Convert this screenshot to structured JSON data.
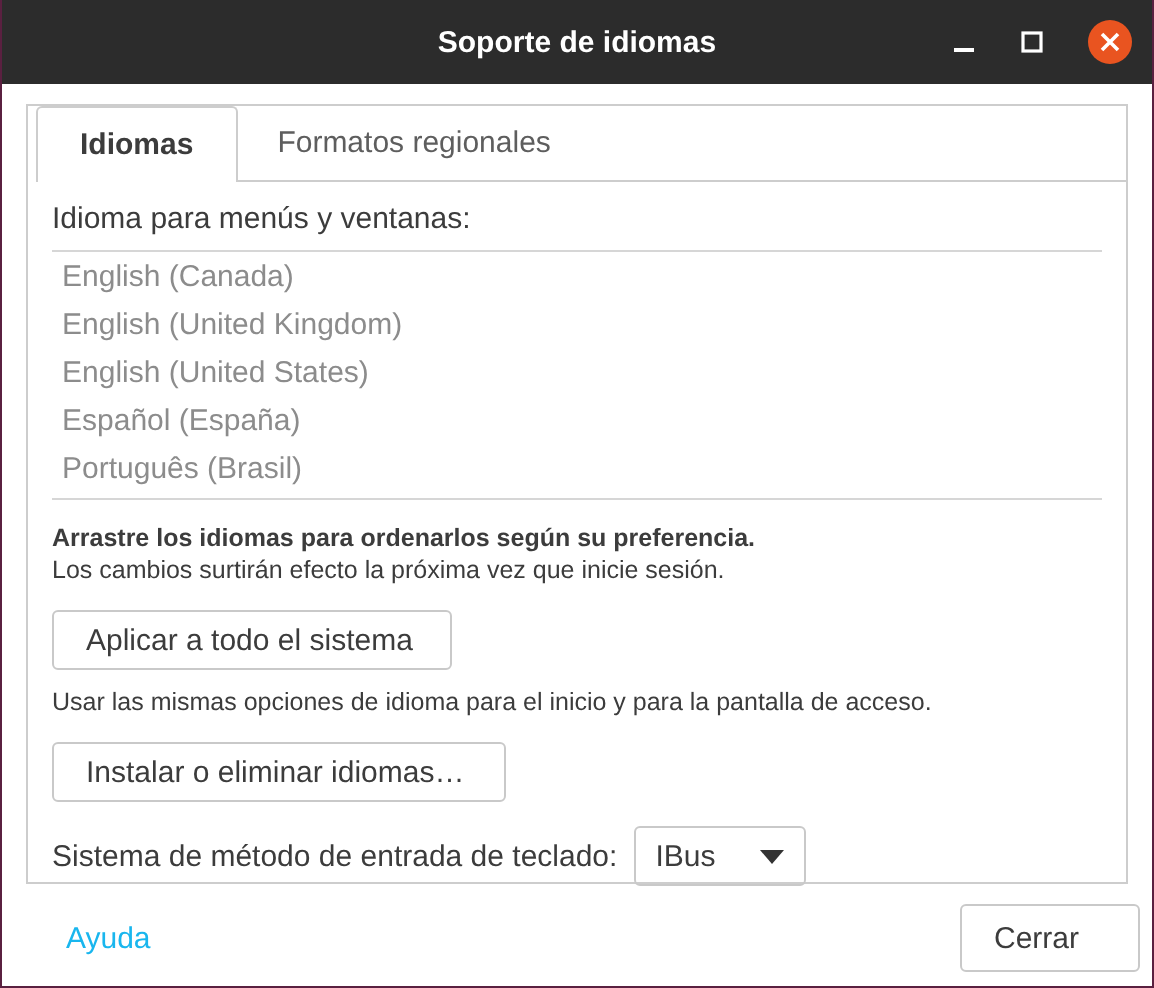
{
  "window": {
    "title": "Soporte de idiomas"
  },
  "tabs": [
    {
      "label": "Idiomas",
      "selected": true
    },
    {
      "label": "Formatos regionales",
      "selected": false
    }
  ],
  "languages": {
    "heading": "Idioma para menús y ventanas:",
    "items": [
      "English (Canada)",
      "English (United Kingdom)",
      "English (United States)",
      "Español (España)",
      "Português (Brasil)"
    ]
  },
  "hint": {
    "bold": "Arrastre los idiomas para ordenarlos según su preferencia.",
    "note": "Los cambios surtirán efecto la próxima vez que inicie sesión."
  },
  "apply_button": "Aplicar a todo el sistema",
  "apply_note": "Usar las mismas opciones de idioma para el inicio y para la pantalla de acceso.",
  "install_button": "Instalar o eliminar idiomas…",
  "input_method": {
    "label": "Sistema de método de entrada de teclado:",
    "value": "IBus"
  },
  "footer": {
    "help": "Ayuda",
    "close": "Cerrar"
  }
}
